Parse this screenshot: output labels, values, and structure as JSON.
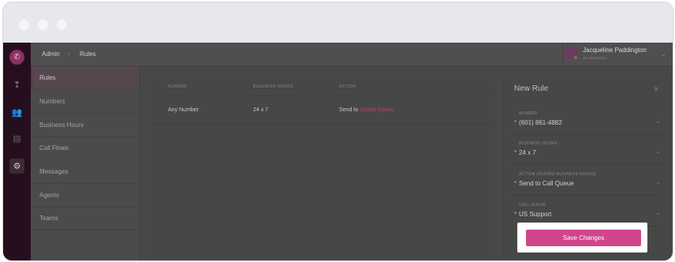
{
  "header": {
    "breadcrumb": [
      "Admin",
      "Rules"
    ],
    "user": {
      "name": "Jacqueline Paddington",
      "status": "ON BROWSER"
    }
  },
  "sidebar": {
    "items": [
      {
        "label": "Rules",
        "active": true
      },
      {
        "label": "Numbers"
      },
      {
        "label": "Business Hours"
      },
      {
        "label": "Call Flows"
      },
      {
        "label": "Messages"
      },
      {
        "label": "Agents"
      },
      {
        "label": "Teams"
      }
    ]
  },
  "rail": {
    "icons": [
      "phone-logo-icon",
      "pin-icon",
      "people-icon",
      "card-icon",
      "gear-icon"
    ],
    "active": "gear-icon"
  },
  "table": {
    "columns": [
      "NUMBER",
      "BUSINESS HOURS",
      "ACTION"
    ],
    "rows": [
      {
        "number": "Any Number",
        "hours": "24 x 7",
        "action_prefix": "Send to",
        "action_target": "Global Queue"
      }
    ]
  },
  "new_rule": {
    "title": "New Rule",
    "fields": [
      {
        "label": "NUMBER",
        "value": "(601) 861-4882"
      },
      {
        "label": "BUSINESS HOURS",
        "value": "24 x 7"
      },
      {
        "label": "ACTION (DURING BUSINESS HOURS)",
        "value": "Send to Call Queue"
      },
      {
        "label": "CALL QUEUE",
        "value": "US Support"
      }
    ],
    "save_label": "Save Changes"
  },
  "colors": {
    "accent": "#d0458b",
    "link": "#b4475c",
    "rail": "#250f1e"
  }
}
